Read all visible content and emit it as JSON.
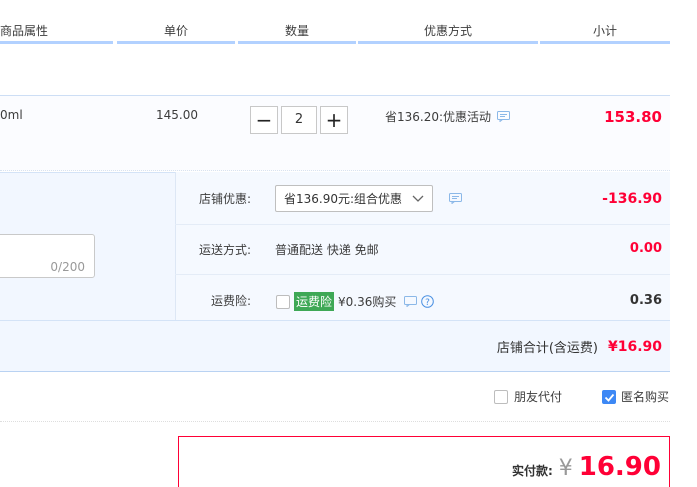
{
  "header": {
    "col_props": "商品属性",
    "col_price": "单价",
    "col_qty": "数量",
    "col_discount": "优惠方式",
    "col_subtotal": "小计"
  },
  "item": {
    "props_text": "0ml",
    "unit_price": "145.00",
    "minus_label": "−",
    "quantity": "2",
    "plus_label": "+",
    "discount_text": "省136.20:优惠活动",
    "subtotal": "153.80"
  },
  "shop": {
    "discount_label": "店铺优惠:",
    "discount_select_value": "省136.90元:组合优惠",
    "discount_amount": "-136.90",
    "shipping_label": "运送方式:",
    "shipping_value": "普通配送 快递 免邮",
    "shipping_amount": "0.00",
    "insurance_label": "运费险:",
    "insurance_tag": "运费险",
    "insurance_price": "¥0.36购买",
    "insurance_amount": "0.36",
    "note_counter": "0/200"
  },
  "totals": {
    "shop_total_label": "店铺合计(含运费)",
    "shop_total_value": "¥16.90"
  },
  "options": {
    "friend_pay_label": "朋友代付",
    "friend_pay_checked": false,
    "anonymous_label": "匿名购买",
    "anonymous_checked": true
  },
  "payment": {
    "label": "实付款:",
    "currency": "¥",
    "amount": "16.90"
  },
  "colors": {
    "accent_red": "#ff0036",
    "header_line": "#b2d1ff",
    "checkbox_blue": "#3d88f5",
    "insurance_green": "#3ea856"
  }
}
